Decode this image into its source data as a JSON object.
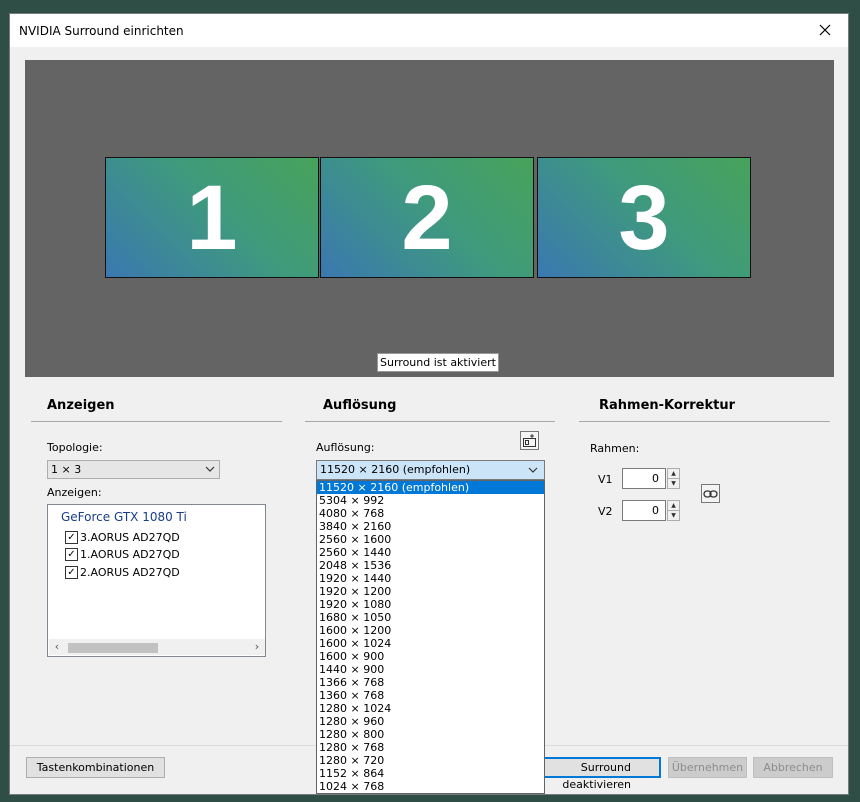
{
  "window": {
    "title": "NVIDIA Surround einrichten"
  },
  "preview": {
    "monitors": [
      "1",
      "2",
      "3"
    ],
    "status": "Surround ist aktiviert"
  },
  "anzeigen": {
    "heading": "Anzeigen",
    "topology_label": "Topologie:",
    "topology_value": "1 × 3",
    "displays_label": "Anzeigen:",
    "gpu": "GeForce GTX 1080 Ti",
    "displays": [
      {
        "label": "3.AORUS AD27QD",
        "checked": true
      },
      {
        "label": "1.AORUS AD27QD",
        "checked": true
      },
      {
        "label": "2.AORUS AD27QD",
        "checked": true
      }
    ]
  },
  "aufloesung": {
    "heading": "Auflösung",
    "label": "Auflösung:",
    "value": "11520 × 2160 (empfohlen)",
    "options": [
      "11520 × 2160 (empfohlen)",
      "5304 × 992",
      "4080 × 768",
      "3840 × 2160",
      "2560 × 1600",
      "2560 × 1440",
      "2048 × 1536",
      "1920 × 1440",
      "1920 × 1200",
      "1920 × 1080",
      "1680 × 1050",
      "1600 × 1200",
      "1600 × 1024",
      "1600 × 900",
      "1440 × 900",
      "1366 × 768",
      "1360 × 768",
      "1280 × 1024",
      "1280 × 960",
      "1280 × 800",
      "1280 × 768",
      "1280 × 720",
      "1152 × 864",
      "1024 × 768"
    ]
  },
  "rahmen": {
    "heading": "Rahmen-Korrektur",
    "label": "Rahmen:",
    "v1_label": "V1",
    "v1_value": "0",
    "v2_label": "V2",
    "v2_value": "0"
  },
  "footer": {
    "shortcuts": "Tastenkombinationen",
    "deactivate": "Surround deaktivieren",
    "apply": "Übernehmen",
    "cancel": "Abbrechen"
  },
  "colors": {
    "accent": "#0078d7",
    "preview_bg": "#646464",
    "gpu_text": "#1a3d8a"
  }
}
